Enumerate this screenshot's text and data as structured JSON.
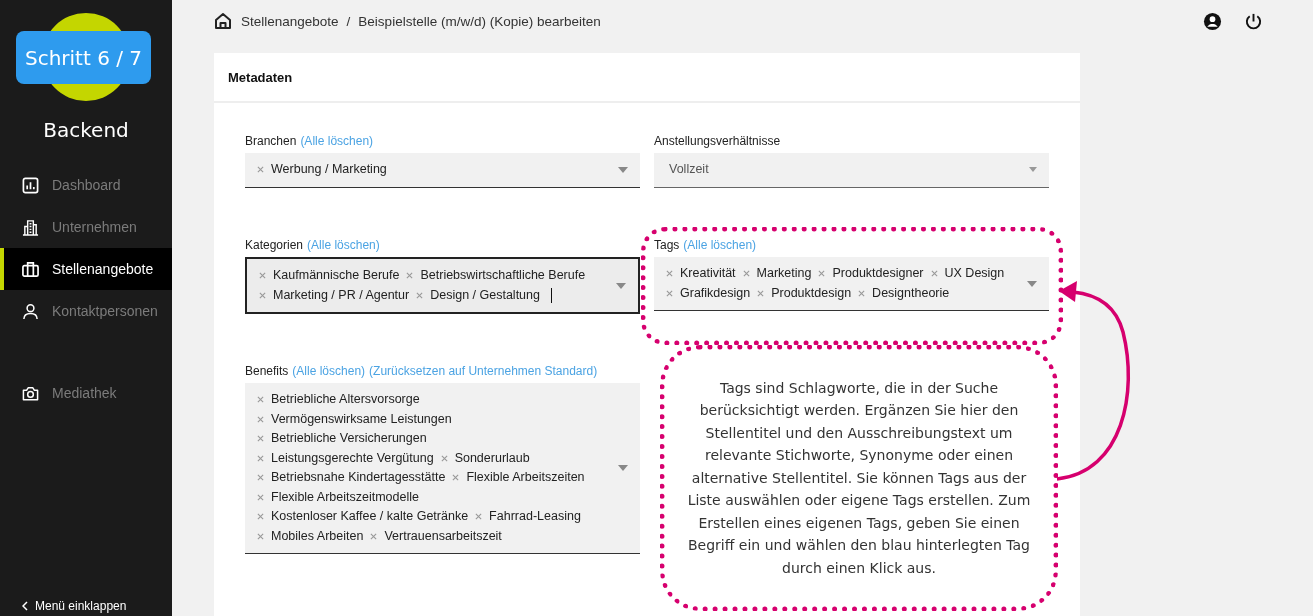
{
  "sidebar": {
    "step_badge": "Schritt 6 / 7",
    "title": "Backend",
    "nav_groups": [
      {
        "items": [
          {
            "label": "Dashboard",
            "selected": false
          },
          {
            "label": "Unternehmen",
            "selected": false
          },
          {
            "label": "Stellenangebote",
            "selected": true
          },
          {
            "label": "Kontaktpersonen",
            "selected": false
          }
        ]
      },
      {
        "items": [
          {
            "label": "Mediathek",
            "selected": false
          }
        ]
      }
    ],
    "collapse": "Menü einklappen"
  },
  "breadcrumb": {
    "items": [
      "Stellenangebote",
      "Beispielstelle (m/w/d) (Kopie) bearbeiten"
    ],
    "separator": "/"
  },
  "card": {
    "title": "Metadaten",
    "fields": [
      {
        "label": "Branchen",
        "links": [
          "(Alle löschen)"
        ],
        "kind": "multi",
        "focused": false,
        "values": [
          "Werbung / Marketing"
        ]
      },
      {
        "label": "Anstellungsverhältnisse",
        "kind": "single",
        "value": "Vollzeit"
      },
      {
        "label": "Kategorien",
        "links": [
          "(Alle löschen)"
        ],
        "kind": "multi",
        "focused": true,
        "values": [
          "Kaufmännische Berufe",
          "Betriebswirtschaftliche Berufe",
          "Marketing / PR / Agentur",
          "Design / Gestaltung"
        ]
      },
      {
        "label": "Tags",
        "links": [
          "(Alle löschen)"
        ],
        "kind": "multi",
        "focused": false,
        "values": [
          "Kreativität",
          "Marketing",
          "Produktdesigner",
          "UX Design",
          "Grafikdesign",
          "Produktdesign",
          "Designtheorie"
        ]
      },
      {
        "label": "Benefits",
        "links": [
          "(Alle löschen)",
          "(Zurücksetzen auf Unternehmen Standard)"
        ],
        "kind": "multi",
        "focused": false,
        "values": [
          "Betriebliche Altersvorsorge",
          "Vermögenswirksame Leistungen",
          "Betriebliche Versicherungen",
          "Leistungsgerechte Vergütung",
          "Sonderurlaub",
          "Betriebsnahe Kindertagesstätte",
          "Flexible Arbeitszeiten",
          "Flexible Arbeitszeitmodelle",
          "Kostenloser Kaffee / kalte Getränke",
          "Fahrrad-Leasing",
          "Mobiles Arbeiten",
          "Vertrauensarbeitszeit"
        ]
      }
    ]
  },
  "annotation": {
    "text": "Tags sind Schlagworte, die in der Suche berücksichtigt werden. Ergänzen Sie hier den Stellentitel und den Ausschreibungstext um relevante Stichworte, Synonyme oder einen alternative Stellentitel. Sie können Tags aus der Liste auswählen oder eigene Tags erstellen. Zum Erstellen eines eigenen Tags, geben Sie einen Begriff ein und wählen den blau hinterlegten Tag durch einen Klick aus."
  }
}
